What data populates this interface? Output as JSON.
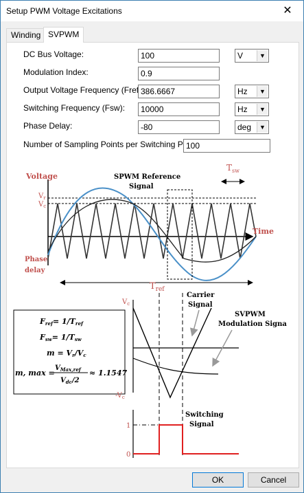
{
  "window": {
    "title": "Setup PWM Voltage Excitations",
    "close_glyph": "✕"
  },
  "tabs": [
    {
      "label": "Winding"
    },
    {
      "label": "SVPWM"
    }
  ],
  "fields": {
    "dc_bus_voltage": {
      "label": "DC Bus Voltage:",
      "value": "100",
      "unit": "V"
    },
    "modulation_index": {
      "label": "Modulation Index:",
      "value": "0.9"
    },
    "output_freq": {
      "label": "Output Voltage Frequency (Fref):",
      "value": "386.6667",
      "unit": "Hz"
    },
    "switching_freq": {
      "label": "Switching Frequency (Fsw):",
      "value": "10000",
      "unit": "Hz"
    },
    "phase_delay": {
      "label": "Phase Delay:",
      "value": "-80",
      "unit": "deg"
    },
    "sampling_points": {
      "label": "Number of Sampling Points per Switching Period:",
      "value": "100"
    }
  },
  "diagram": {
    "voltage": "Voltage",
    "spwm_ref": "SPWM Reference",
    "signal": "Signal",
    "tsw": "T",
    "tsw_sub": "sw",
    "vr": "V",
    "vr_sub": "r",
    "vc": "V",
    "vc_sub": "c",
    "time": "Time",
    "phase": "Phase",
    "delay": "delay",
    "tref": "T",
    "tref_sub": "ref",
    "carrier": "Carrier",
    "carrier_signal": "Signal",
    "svpwm": "SVPWM",
    "svpwm_mod": "Modulation Signal",
    "vc_axis": "V",
    "vc_axis_sub": "c",
    "neg_vc": "-V",
    "neg_vc_sub": "c",
    "switching": "Switching",
    "switching_signal": "Signal",
    "one": "1",
    "zero": "0",
    "eq1": "F",
    "eq1_sub": "ref",
    "eq1_rhs": "= 1/T",
    "eq1_rhs_sub": "ref",
    "eq2": "F",
    "eq2_sub": "sw",
    "eq2_rhs": "= 1/T",
    "eq2_rhs_sub": "sw",
    "eq3": "m = V",
    "eq3_sub": "r",
    "eq3_rhs": "/V",
    "eq3_rhs_sub": "c",
    "eq4": "m, max =",
    "eq4_num": "V",
    "eq4_num_sub": "Max,ref",
    "eq4_den": "V",
    "eq4_den_sub": "dc",
    "eq4_den_rhs": "/2",
    "eq4_result": "≈ 1.1547"
  },
  "buttons": {
    "ok": "OK",
    "cancel": "Cancel"
  },
  "colors": {
    "accent_red": "#c0504d",
    "ref_blue": "#4a90c8",
    "switch_red": "#e02020"
  }
}
